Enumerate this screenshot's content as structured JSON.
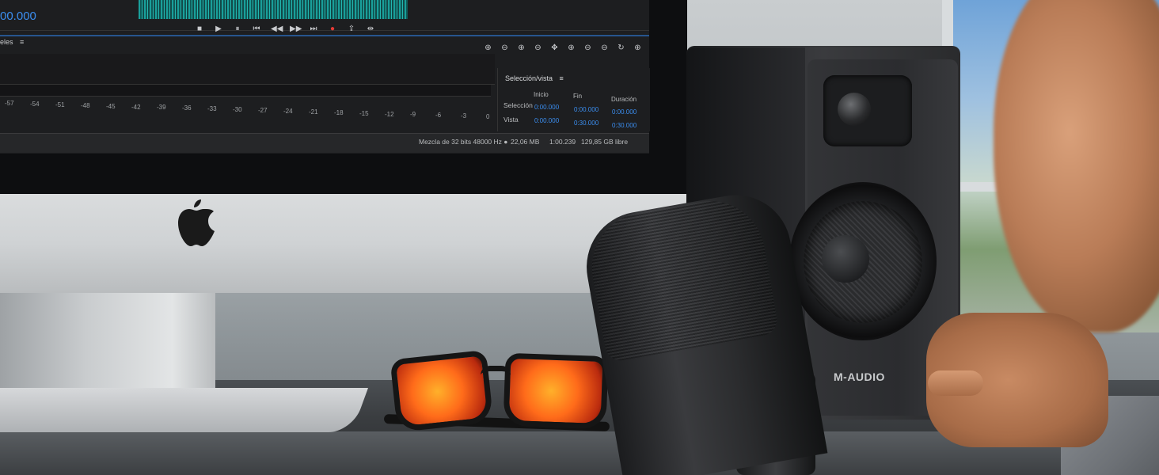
{
  "screen": {
    "time_readout": "00.000",
    "meters_tab": "eles",
    "meters_tab_menu": "≡",
    "transport": [
      "■",
      "▶",
      "⏸",
      "⏮",
      "◀◀",
      "▶▶",
      "⏭",
      "●",
      "⇪",
      "⇹"
    ],
    "zoom_tools": [
      "⊕",
      "⊖",
      "⊕",
      "⊖",
      "✥",
      "⊕",
      "⊖",
      "⊖",
      "↻",
      "⊕"
    ],
    "meter_scale": [
      "-57",
      "-54",
      "-51",
      "-48",
      "-45",
      "-42",
      "-39",
      "-36",
      "-33",
      "-30",
      "-27",
      "-24",
      "-21",
      "-18",
      "-15",
      "-12",
      "-9",
      "-6",
      "-3",
      "0"
    ],
    "selection_panel": {
      "title": "Selección/vista",
      "menu": "≡",
      "col_start": "Inicio",
      "col_end": "Fin",
      "col_duration": "Duración",
      "row_selection": "Selección",
      "row_view": "Vista",
      "selection_start": "0:00.000",
      "selection_end": "0:00.000",
      "selection_duration": "0:00.000",
      "view_start": "0:00.000",
      "view_end": "0:30.000",
      "view_duration": "0:30.000"
    },
    "status": {
      "mix": "Mezcla de 32 bits 48000 Hz ●",
      "size": "22,06 MB",
      "duration": "1:00.239",
      "free": "129,85 GB libre"
    },
    "colors": {
      "accent": "#3b8ef0",
      "waveform": "#19a6a1",
      "record": "#e53b36"
    }
  },
  "speaker": {
    "brand": "M-AUDIO"
  },
  "icons": {
    "computer_logo": "apple-logo-icon"
  }
}
